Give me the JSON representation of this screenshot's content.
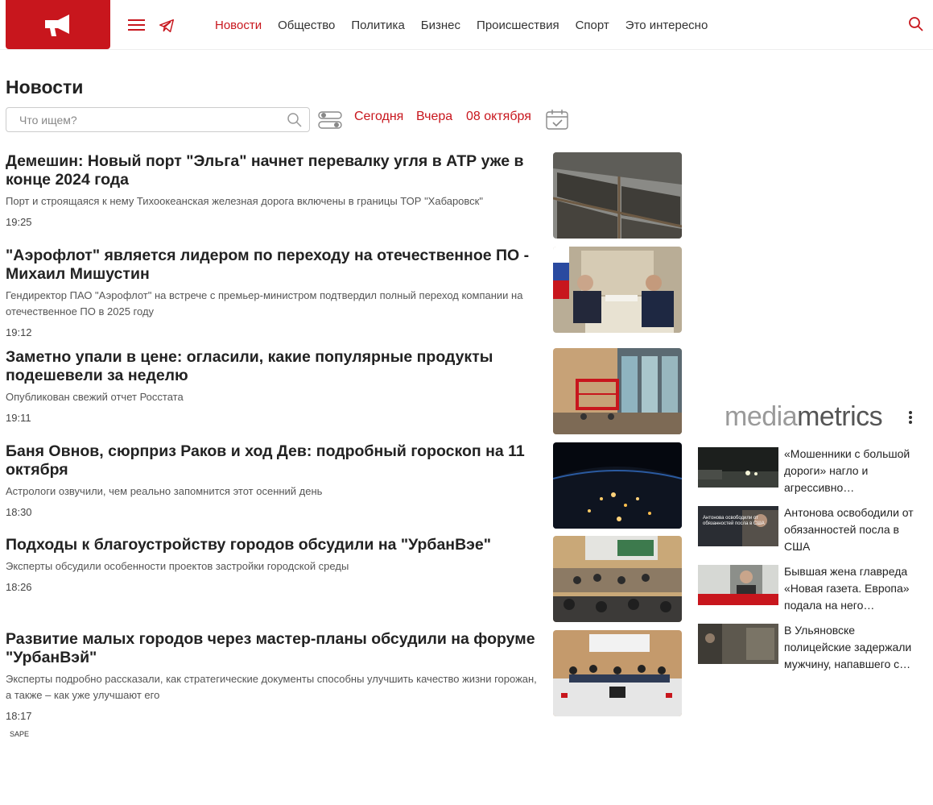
{
  "header": {
    "nav": [
      {
        "label": "Новости",
        "active": true
      },
      {
        "label": "Общество",
        "active": false
      },
      {
        "label": "Политика",
        "active": false
      },
      {
        "label": "Бизнес",
        "active": false
      },
      {
        "label": "Происшествия",
        "active": false
      },
      {
        "label": "Спорт",
        "active": false
      },
      {
        "label": "Это интересно",
        "active": false
      }
    ]
  },
  "page_title": "Новости",
  "filters": {
    "search_placeholder": "Что ищем?",
    "today": "Сегодня",
    "yesterday": "Вчера",
    "date": "08 октября"
  },
  "articles": [
    {
      "title": "Демешин: Новый порт \"Эльга\" начнет перевалку угля в АТР уже в конце 2024 года",
      "lead": "Порт и строящаяся к нему Тихоокеанская железная дорога включены в границы ТОР \"Хабаровск\"",
      "time": "19:25"
    },
    {
      "title": "\"Аэрофлот\" является лидером по переходу на отечественное ПО - Михаил Мишустин",
      "lead": "Гендиректор ПАО \"Аэрофлот\" на встрече с премьер-министром подтвердил полный переход компании на отечественное ПО в 2025 году",
      "time": "19:12"
    },
    {
      "title": "Заметно упали в цене: огласили, какие популярные продукты подешевели за неделю",
      "lead": "Опубликован свежий отчет Росстата",
      "time": "19:11"
    },
    {
      "title": "Баня Овнов, сюрприз Раков и ход Дев: подробный гороскоп на 11 октября",
      "lead": "Астрологи озвучили, чем реально запомнится этот осенний день",
      "time": "18:30"
    },
    {
      "title": "Подходы к благоустройству городов обсудили на \"УрбанВэе\"",
      "lead": "Эксперты обсудили особенности проектов застройки городской среды",
      "time": "18:26"
    },
    {
      "title": "Развитие малых городов через мастер-планы обсудили на форуме \"УрбанВэй\"",
      "lead": "Эксперты подробно рассказали, как стратегические документы способны улучшить качество жизни горожан, а также – как уже улучшают его",
      "time": "18:17"
    }
  ],
  "sape": "SAPE",
  "mediametrics": {
    "logo_light": "media",
    "logo_dark": "metrics",
    "items": [
      {
        "text": "«Мошенники с большой дороги» нагло и агрессивно…"
      },
      {
        "text": "Антонова освободили от обязанностей посла в США",
        "thumb_caption": "Антонова освободили от обязанностей посла в США"
      },
      {
        "text": "Бывшая жена главреда «Новая газета. Европа» подала на него…"
      },
      {
        "text": "В Ульяновске полицейские задержали мужчину, напавшего с…"
      }
    ]
  },
  "colors": {
    "accent": "#c8161d",
    "text": "#222222",
    "muted": "#555555"
  }
}
